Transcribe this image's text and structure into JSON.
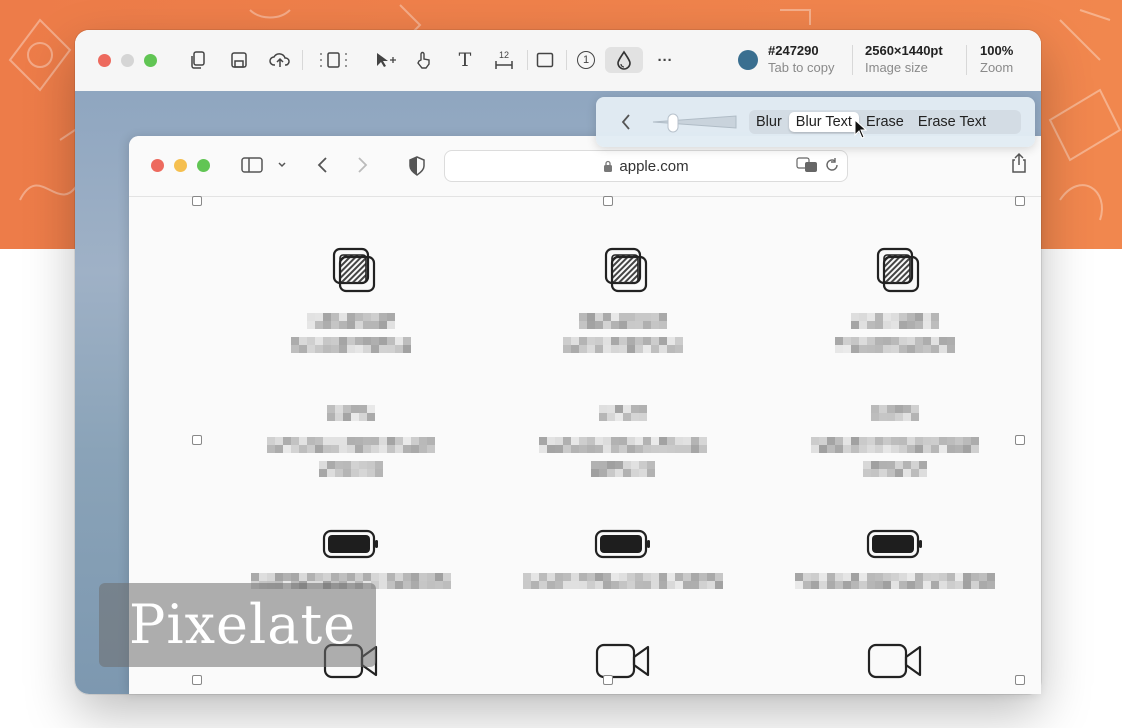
{
  "toolbar": {
    "color_hex": "#247290",
    "color_hint": "Tab to copy",
    "image_size_value": "2560×1440pt",
    "image_size_label": "Image size",
    "zoom_value": "100%",
    "zoom_label": "Zoom",
    "swatch_color": "#3a6f90",
    "text_tool_glyph": "T",
    "ruler_value": "12",
    "step_number": "1",
    "more_glyph": "···"
  },
  "popover": {
    "modes": [
      "Blur",
      "Blur Text",
      "Erase",
      "Erase Text"
    ],
    "selected_mode": "Blur Text"
  },
  "browser": {
    "url": "apple.com"
  },
  "badge": {
    "label": "Pixelate"
  },
  "colors": {
    "accent_orange": "#ef8049",
    "close": "#ed6a5e",
    "minimize": "#f5bf4f",
    "zoom": "#61c554"
  }
}
